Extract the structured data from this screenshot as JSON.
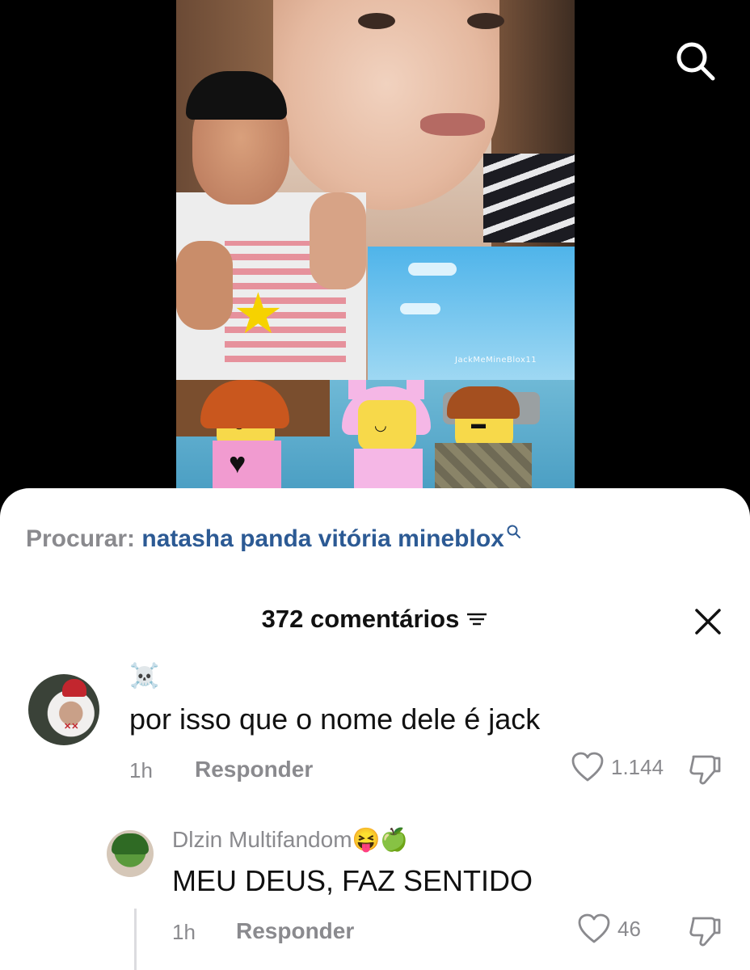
{
  "video": {
    "watermark": "JackMeMineBlox11"
  },
  "search": {
    "label": "Procurar:",
    "query": "natasha panda vitória mineblox"
  },
  "comments_header": {
    "count_label": "372 comentários"
  },
  "comments": [
    {
      "username_emoji": "☠️",
      "text": "por isso que o nome dele é jack",
      "time": "1h",
      "reply_label": "Responder",
      "likes": "1.144"
    },
    {
      "username": "Dlzin Multifandom😝🍏",
      "text": "MEU DEUS, FAZ SENTIDO",
      "time": "1h",
      "reply_label": "Responder",
      "likes": "46"
    }
  ],
  "colors": {
    "search_query": "#2c5a94",
    "muted_text": "#8a8a8e",
    "sheet_bg": "#ffffff"
  },
  "icons": [
    "search-icon",
    "search-mini-icon",
    "filter-icon",
    "close-icon",
    "heart-icon",
    "dislike-icon"
  ]
}
